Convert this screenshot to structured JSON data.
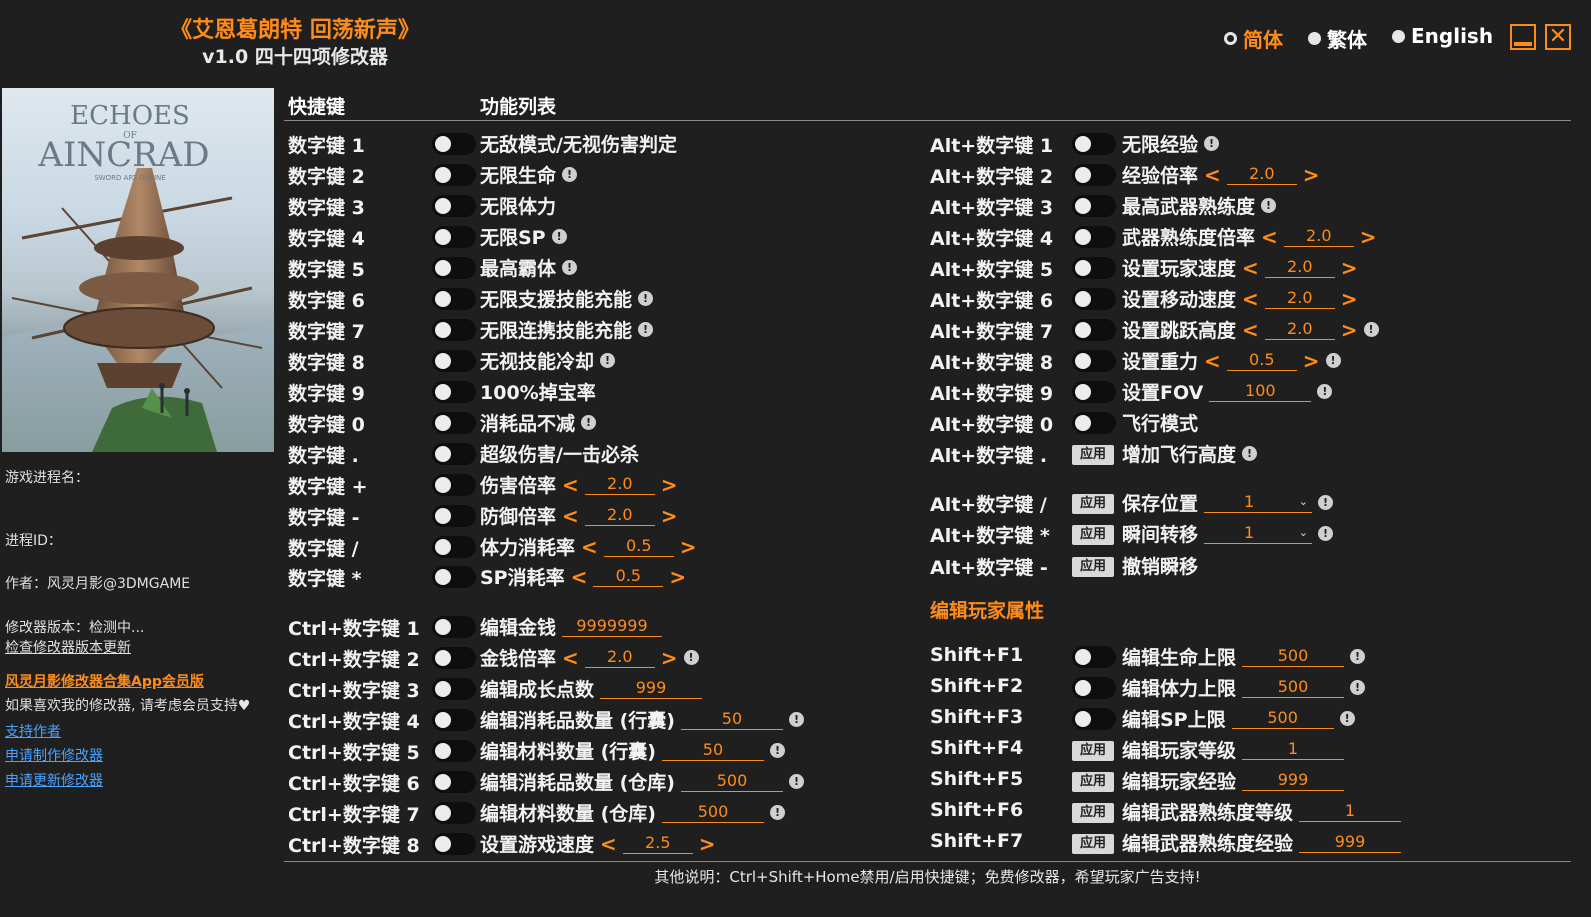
{
  "header": {
    "title": "《艾恩葛朗特 回荡新声》",
    "subtitle": "v1.0 四十四项修改器"
  },
  "languages": [
    {
      "label": "简体",
      "selected": true
    },
    {
      "label": "繁体",
      "selected": false
    },
    {
      "label": "English",
      "selected": false
    }
  ],
  "window": {
    "close_glyph": "✕"
  },
  "cover": {
    "line1": "ECHOES",
    "line2": "OF",
    "line3": "AINCRAD",
    "line4": "SWORD ART ONLINE"
  },
  "sidebar": {
    "process_name_label": "游戏进程名：",
    "process_id_label": "进程ID：",
    "author": "作者：风灵月影@3DMGAME",
    "version": "修改器版本：检测中...",
    "check_update": "检查修改器版本更新",
    "promo": "风灵月影修改器合集App会员版",
    "support_text": "如果喜欢我的修改器, 请考虑会员支持",
    "heart": "♥",
    "links": [
      "支持作者",
      "申请制作修改器",
      "申请更新修改器"
    ]
  },
  "table": {
    "col_hotkey": "快捷键",
    "col_features": "功能列表",
    "section_edit": "编辑玩家属性",
    "left": [
      {
        "hotkey": "数字键 1",
        "label": "无敌模式/无视伤害判定",
        "control": "toggle"
      },
      {
        "hotkey": "数字键 2",
        "label": "无限生命",
        "control": "toggle",
        "warn": true
      },
      {
        "hotkey": "数字键 3",
        "label": "无限体力",
        "control": "toggle"
      },
      {
        "hotkey": "数字键 4",
        "label": "无限SP",
        "control": "toggle",
        "warn": true
      },
      {
        "hotkey": "数字键 5",
        "label": "最高霸体",
        "control": "toggle",
        "warn": true
      },
      {
        "hotkey": "数字键 6",
        "label": "无限支援技能充能",
        "control": "toggle",
        "warn": true
      },
      {
        "hotkey": "数字键 7",
        "label": "无限连携技能充能",
        "control": "toggle",
        "warn": true
      },
      {
        "hotkey": "数字键 8",
        "label": "无视技能冷却",
        "control": "toggle",
        "warn": true
      },
      {
        "hotkey": "数字键 9",
        "label": "100%掉宝率",
        "control": "toggle"
      },
      {
        "hotkey": "数字键 0",
        "label": "消耗品不减",
        "control": "toggle",
        "warn": true
      },
      {
        "hotkey": "数字键 .",
        "label": "超级伤害/一击必杀",
        "control": "toggle"
      },
      {
        "hotkey": "数字键 +",
        "label": "伤害倍率",
        "control": "toggle",
        "value": "2.0",
        "arrows": true
      },
      {
        "hotkey": "数字键 -",
        "label": "防御倍率",
        "control": "toggle",
        "value": "2.0",
        "arrows": true
      },
      {
        "hotkey": "数字键 /",
        "label": "体力消耗率",
        "control": "toggle",
        "value": "0.5",
        "arrows": true
      },
      {
        "hotkey": "数字键 *",
        "label": "SP消耗率",
        "control": "toggle",
        "value": "0.5",
        "arrows": true
      },
      {
        "hotkey": "Ctrl+数字键 1",
        "label": "编辑金钱",
        "control": "toggle",
        "value": "9999999"
      },
      {
        "hotkey": "Ctrl+数字键 2",
        "label": "金钱倍率",
        "control": "toggle",
        "value": "2.0",
        "arrows": true,
        "warn": true
      },
      {
        "hotkey": "Ctrl+数字键 3",
        "label": "编辑成长点数",
        "control": "toggle",
        "value": "999"
      },
      {
        "hotkey": "Ctrl+数字键 4",
        "label": "编辑消耗品数量 (行囊)",
        "control": "toggle",
        "value": "50",
        "warn": true
      },
      {
        "hotkey": "Ctrl+数字键 5",
        "label": "编辑材料数量 (行囊)",
        "control": "toggle",
        "value": "50",
        "warn": true
      },
      {
        "hotkey": "Ctrl+数字键 6",
        "label": "编辑消耗品数量 (仓库)",
        "control": "toggle",
        "value": "500",
        "warn": true
      },
      {
        "hotkey": "Ctrl+数字键 7",
        "label": "编辑材料数量 (仓库)",
        "control": "toggle",
        "value": "500",
        "warn": true
      },
      {
        "hotkey": "Ctrl+数字键 8",
        "label": "设置游戏速度",
        "control": "toggle",
        "value": "2.5",
        "arrows": true
      }
    ],
    "right": [
      {
        "hotkey": "Alt+数字键 1",
        "label": "无限经验",
        "control": "toggle",
        "warn": true
      },
      {
        "hotkey": "Alt+数字键 2",
        "label": "经验倍率",
        "control": "toggle",
        "value": "2.0",
        "arrows": true
      },
      {
        "hotkey": "Alt+数字键 3",
        "label": "最高武器熟练度",
        "control": "toggle",
        "warn": true
      },
      {
        "hotkey": "Alt+数字键 4",
        "label": "武器熟练度倍率",
        "control": "toggle",
        "value": "2.0",
        "arrows": true
      },
      {
        "hotkey": "Alt+数字键 5",
        "label": "设置玩家速度",
        "control": "toggle",
        "value": "2.0",
        "arrows": true
      },
      {
        "hotkey": "Alt+数字键 6",
        "label": "设置移动速度",
        "control": "toggle",
        "value": "2.0",
        "arrows": true
      },
      {
        "hotkey": "Alt+数字键 7",
        "label": "设置跳跃高度",
        "control": "toggle",
        "value": "2.0",
        "arrows": true,
        "warn": true
      },
      {
        "hotkey": "Alt+数字键 8",
        "label": "设置重力",
        "control": "toggle",
        "value": "0.5",
        "arrows": true,
        "warn": true
      },
      {
        "hotkey": "Alt+数字键 9",
        "label": "设置FOV",
        "control": "toggle",
        "value": "100",
        "warn": true
      },
      {
        "hotkey": "Alt+数字键 0",
        "label": "飞行模式",
        "control": "toggle"
      },
      {
        "hotkey": "Alt+数字键 .",
        "label": "增加飞行高度",
        "control": "apply",
        "warn": true
      },
      {
        "hotkey": "Alt+数字键 /",
        "label": "保存位置",
        "control": "apply",
        "dropdown": "1",
        "warn": true
      },
      {
        "hotkey": "Alt+数字键 *",
        "label": "瞬间转移",
        "control": "apply",
        "dropdown": "1",
        "warn": true
      },
      {
        "hotkey": "Alt+数字键 -",
        "label": "撤销瞬移",
        "control": "apply"
      },
      {
        "hotkey": "Shift+F1",
        "label": "编辑生命上限",
        "control": "toggle",
        "value": "500",
        "warn": true
      },
      {
        "hotkey": "Shift+F2",
        "label": "编辑体力上限",
        "control": "toggle",
        "value": "500",
        "warn": true
      },
      {
        "hotkey": "Shift+F3",
        "label": "编辑SP上限",
        "control": "toggle",
        "value": "500",
        "warn": true
      },
      {
        "hotkey": "Shift+F4",
        "label": "编辑玩家等级",
        "control": "apply",
        "value": "1"
      },
      {
        "hotkey": "Shift+F5",
        "label": "编辑玩家经验",
        "control": "apply",
        "value": "999"
      },
      {
        "hotkey": "Shift+F6",
        "label": "编辑武器熟练度等级",
        "control": "apply",
        "value": "1"
      },
      {
        "hotkey": "Shift+F7",
        "label": "编辑武器熟练度经验",
        "control": "apply",
        "value": "999"
      }
    ],
    "apply_label": "应用",
    "warn_glyph": "!",
    "arrow_left": "<",
    "arrow_right": ">",
    "dropdown_caret": "⌄"
  },
  "footer": "其他说明：Ctrl+Shift+Home禁用/启用快捷键；免费修改器，希望玩家广告支持!",
  "colors": {
    "accent": "#ff8c1a",
    "background": "#1f1f1f",
    "link": "#4aa3ff"
  }
}
